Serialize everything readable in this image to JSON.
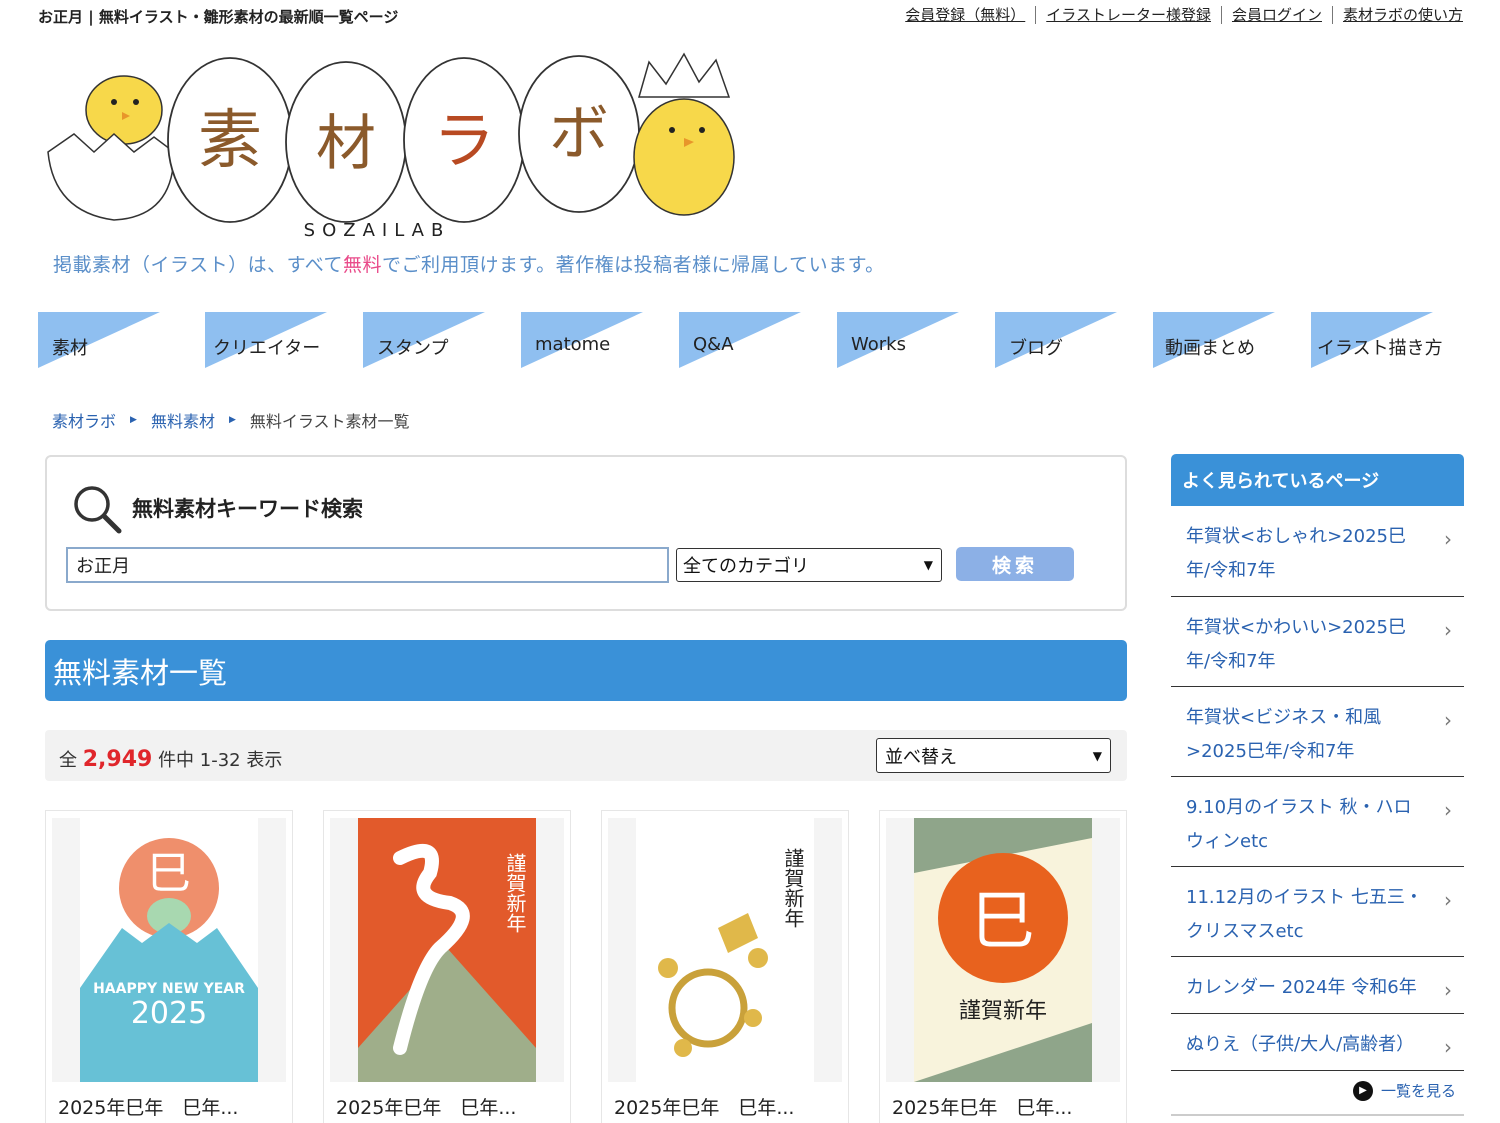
{
  "page_title": "お正月 | 無料イラスト・雛形素材の最新順一覧ページ",
  "top_links": [
    "会員登録（無料）",
    "イラストレーター様登録",
    "会員ログイン",
    "素材ラボの使い方"
  ],
  "logo": {
    "chars": [
      "素",
      "材",
      "ラ",
      "ボ"
    ],
    "sub": "SOZAILAB"
  },
  "tagline": {
    "before": "掲載素材（イラスト）は、すべて",
    "free": "無料",
    "after": "でご利用頂けます。著作権は投稿者様に帰属しています。"
  },
  "nav": [
    {
      "label": "素材"
    },
    {
      "label": "クリエイター"
    },
    {
      "label": "スタンプ"
    },
    {
      "label": "matome"
    },
    {
      "label": "Q&A"
    },
    {
      "label": "Works"
    },
    {
      "label": "ブログ"
    },
    {
      "label": "動画まとめ"
    },
    {
      "label": "イラスト描き方"
    }
  ],
  "breadcrumb": {
    "home": "素材ラボ",
    "level2": "無料素材",
    "current": "無料イラスト素材一覧"
  },
  "search": {
    "title": "無料素材キーワード検索",
    "value": "お正月",
    "category": "全てのカテゴリ",
    "button": "検索"
  },
  "list": {
    "header": "無料素材一覧",
    "count_prefix": "全",
    "count": "2,949",
    "count_suffix": "件中 1-32 表示",
    "sort": "並べ替え"
  },
  "cards": [
    {
      "caption": "2025年巳年　巳年...",
      "art": {
        "kana": "巳",
        "text1": "HAAPPY NEW YEAR",
        "text2": "2025"
      }
    },
    {
      "caption": "2025年巳年　巳年...",
      "art": {
        "kana": "謹賀新年"
      }
    },
    {
      "caption": "2025年巳年　巳年...",
      "art": {
        "kana": "謹賀新年"
      }
    },
    {
      "caption": "2025年巳年　巳年...",
      "art": {
        "kana": "巳",
        "text1": "謹賀新年"
      }
    }
  ],
  "sidebar": {
    "title": "よく見られているページ",
    "items": [
      "年賀状<おしゃれ>2025巳年/令和7年",
      "年賀状<かわいい>2025巳年/令和7年",
      "年賀状<ビジネス・和風>2025巳年/令和7年",
      "9.10月のイラスト 秋・ハロウィンetc",
      "11.12月のイラスト 七五三・クリスマスetc",
      "カレンダー 2024年 令和6年",
      "ぬりえ（子供/大人/高齢者）"
    ],
    "more": "一覧を見る"
  },
  "colors": {
    "accent": "#3a91d8",
    "link": "#2a62b0",
    "count": "#e0262b",
    "nav_tri": "#8fbff0"
  }
}
